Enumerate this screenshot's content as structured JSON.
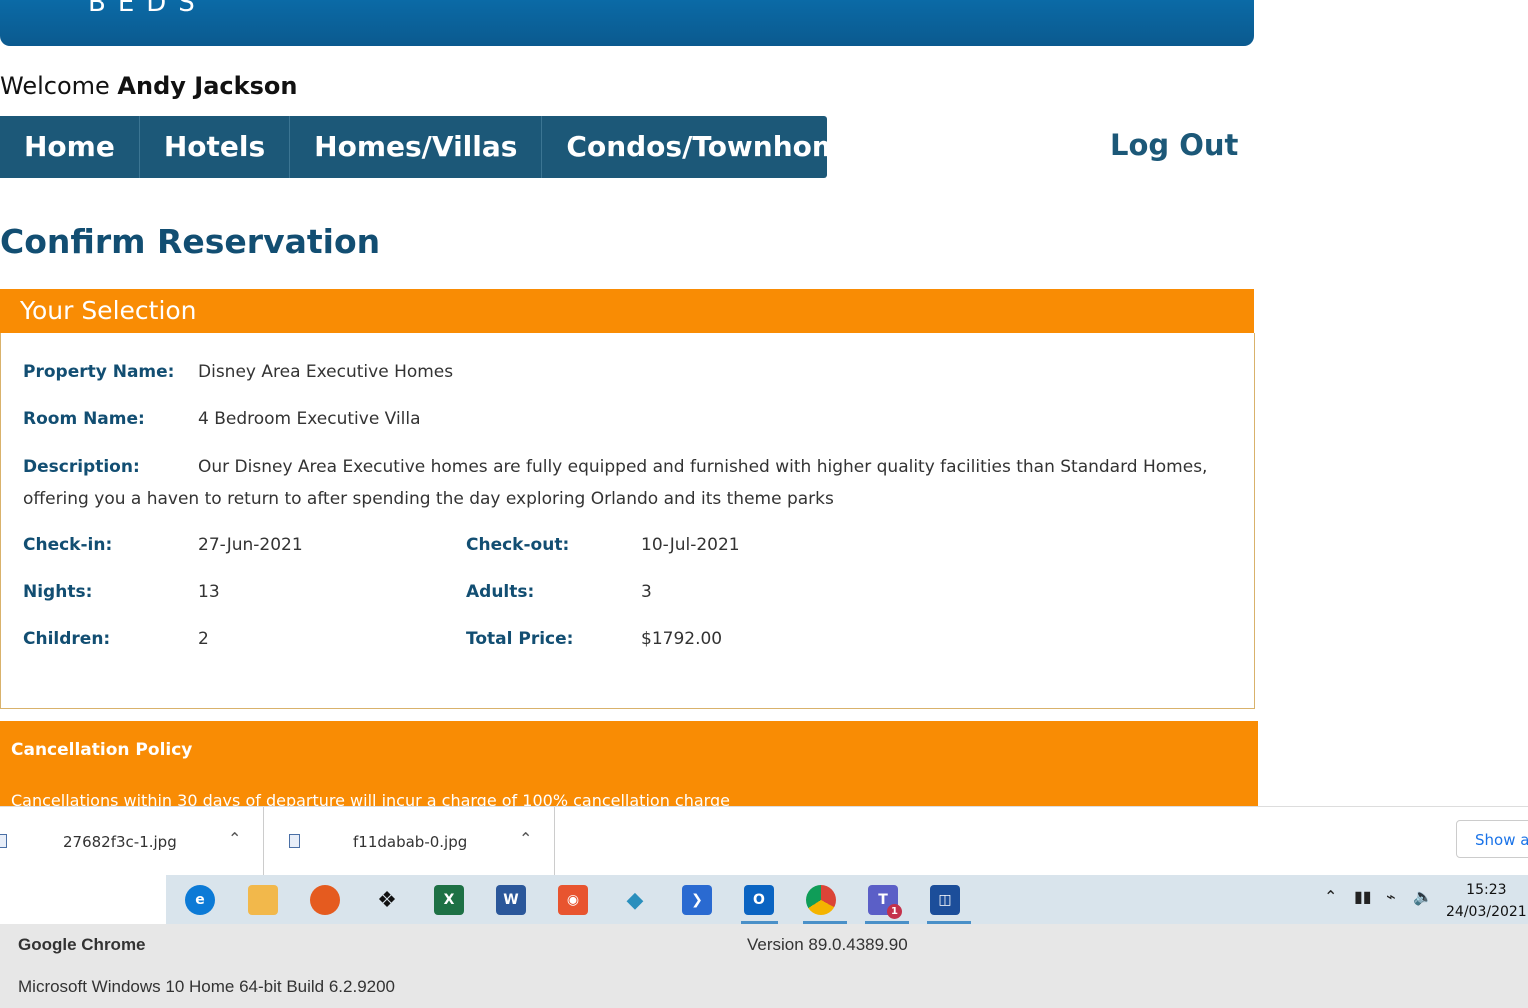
{
  "header": {
    "logo_text": "BEDS"
  },
  "welcome": {
    "prefix": "Welcome",
    "user": "Andy Jackson"
  },
  "nav": {
    "items": [
      "Home",
      "Hotels",
      "Homes/Villas",
      "Condos/Townhomes"
    ],
    "logout": "Log Out"
  },
  "page_title": "Confirm Reservation",
  "selection": {
    "heading": "Your Selection",
    "property_label": "Property Name:",
    "property_value": "Disney Area Executive Homes",
    "room_label": "Room Name:",
    "room_value": "4 Bedroom Executive Villa",
    "description_label": "Description:",
    "description_value": "Our Disney Area Executive homes are fully equipped and furnished with higher quality facilities than Standard Homes, offering you a haven to return to after spending the day exploring Orlando and its theme parks",
    "checkin_label": "Check-in:",
    "checkin_value": "27-Jun-2021",
    "checkout_label": "Check-out:",
    "checkout_value": "10-Jul-2021",
    "nights_label": "Nights:",
    "nights_value": "13",
    "adults_label": "Adults:",
    "adults_value": "3",
    "children_label": "Children:",
    "children_value": "2",
    "total_label": "Total Price:",
    "total_value": "$1792.00"
  },
  "cancellation": {
    "title": "Cancellation Policy",
    "text": "Cancellations within 30 days of departure will incur a charge of 100% cancellation charge"
  },
  "downloads": {
    "items": [
      "27682f3c-1.jpg",
      "f11dabab-0.jpg"
    ],
    "show_all": "Show all"
  },
  "taskbar": {
    "time": "15:23",
    "date": "24/03/2021",
    "icons": [
      "edge-icon",
      "file-explorer-icon",
      "firefox-icon",
      "dropbox-icon",
      "excel-icon",
      "word-icon",
      "office-lens-icon",
      "layers-icon",
      "power-automate-icon",
      "outlook-icon",
      "chrome-icon",
      "teams-icon",
      "remote-desktop-icon"
    ],
    "teams_badge": "1"
  },
  "system_info": {
    "browser": "Google Chrome",
    "version": "Version 89.0.4389.90",
    "os": "Microsoft Windows 10 Home 64-bit Build 6.2.9200"
  },
  "colors": {
    "accent_orange": "#f98c04",
    "nav_blue": "#1c5878",
    "title_blue": "#124e72"
  }
}
